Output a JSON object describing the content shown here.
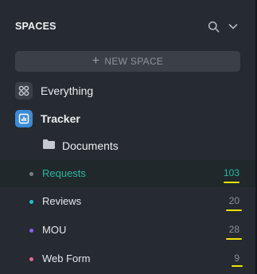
{
  "header": {
    "title": "SPACES"
  },
  "new_space": {
    "label": "NEW SPACE"
  },
  "spaces": [
    {
      "label": "Everything",
      "icon": "grid-icon",
      "color": "#3b4048"
    },
    {
      "label": "Tracker",
      "icon": "chart-icon",
      "color": "#3d8bd4"
    }
  ],
  "folder": {
    "label": "Documents",
    "icon": "folder-icon"
  },
  "lists": [
    {
      "name": "Requests",
      "count": "103",
      "dot_color": "#7a8089",
      "active": true
    },
    {
      "name": "Reviews",
      "count": "20",
      "dot_color": "#20c0d8",
      "active": false
    },
    {
      "name": "MOU",
      "count": "28",
      "dot_color": "#8b5cf6",
      "active": false
    },
    {
      "name": "Web Form",
      "count": "9",
      "dot_color": "#f06292",
      "active": false
    }
  ],
  "colors": {
    "accent": "#27b9a2",
    "highlight_underline": "#f4e300"
  }
}
